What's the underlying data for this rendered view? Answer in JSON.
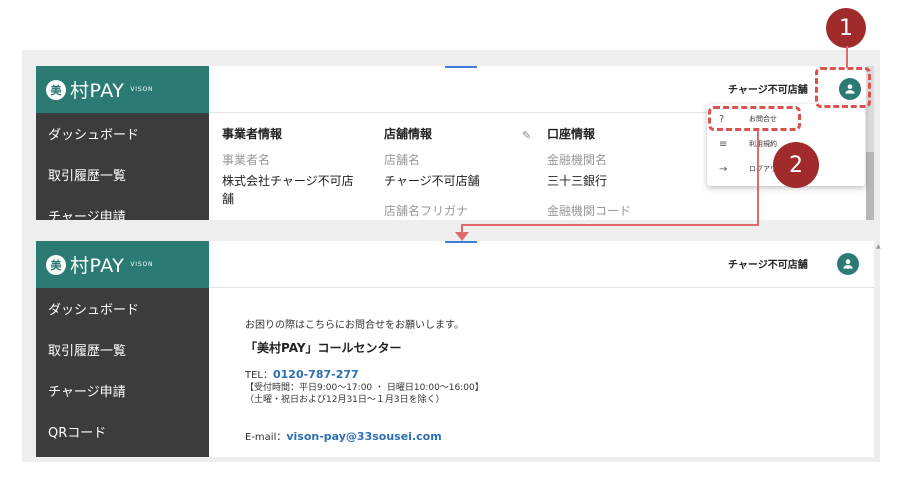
{
  "brand": {
    "logo_mark": "美",
    "logo_text": "村PAY",
    "logo_sub": "VISON"
  },
  "header": {
    "store_name": "チャージ不可店舗"
  },
  "nav_top": [
    {
      "label": "ダッシュボード"
    },
    {
      "label": "取引履歴一覧"
    },
    {
      "label": "チャージ申請"
    }
  ],
  "nav_bottom": [
    {
      "label": "ダッシュボード"
    },
    {
      "label": "取引履歴一覧"
    },
    {
      "label": "チャージ申請"
    },
    {
      "label": "QRコード"
    }
  ],
  "info": {
    "business": {
      "heading": "事業者情報",
      "label": "事業者名",
      "value_line1": "株式会社チャージ不可店",
      "value_line2": "舗"
    },
    "store": {
      "heading": "店舗情報",
      "label": "店舗名",
      "value": "チャージ不可店舗",
      "label2": "店舗名フリガナ"
    },
    "bank": {
      "heading": "口座情報",
      "label": "金融機関名",
      "value": "三十三銀行",
      "label2": "金融機関コード"
    }
  },
  "menu": {
    "items": [
      {
        "icon": "?",
        "label": "お問合せ"
      },
      {
        "icon": "≡",
        "label": "利用規約"
      },
      {
        "icon": "→",
        "label": "ログアウト"
      }
    ]
  },
  "callouts": {
    "step1": "1",
    "step2": "2"
  },
  "contact": {
    "intro": "お困りの際はこちらにお問合せをお願いします。",
    "center_name": "「美村PAY」コールセンター",
    "tel_label": "TEL：",
    "tel_number": "0120-787-277",
    "hours_line1": "【受付時間：平日9:00〜17:00 ・ 日曜日10:00〜16:00】",
    "hours_line2": "（土曜・祝日および12月31日〜１月3日を除く）",
    "mail_label": "E-mail：",
    "mail_address": "vison-pay@33sousei.com"
  },
  "colors": {
    "brand": "#2b7b74",
    "sidebar": "#3c3c3c",
    "callout": "#a12a2a",
    "highlight": "#d9534f",
    "link": "#2b6fb5"
  }
}
